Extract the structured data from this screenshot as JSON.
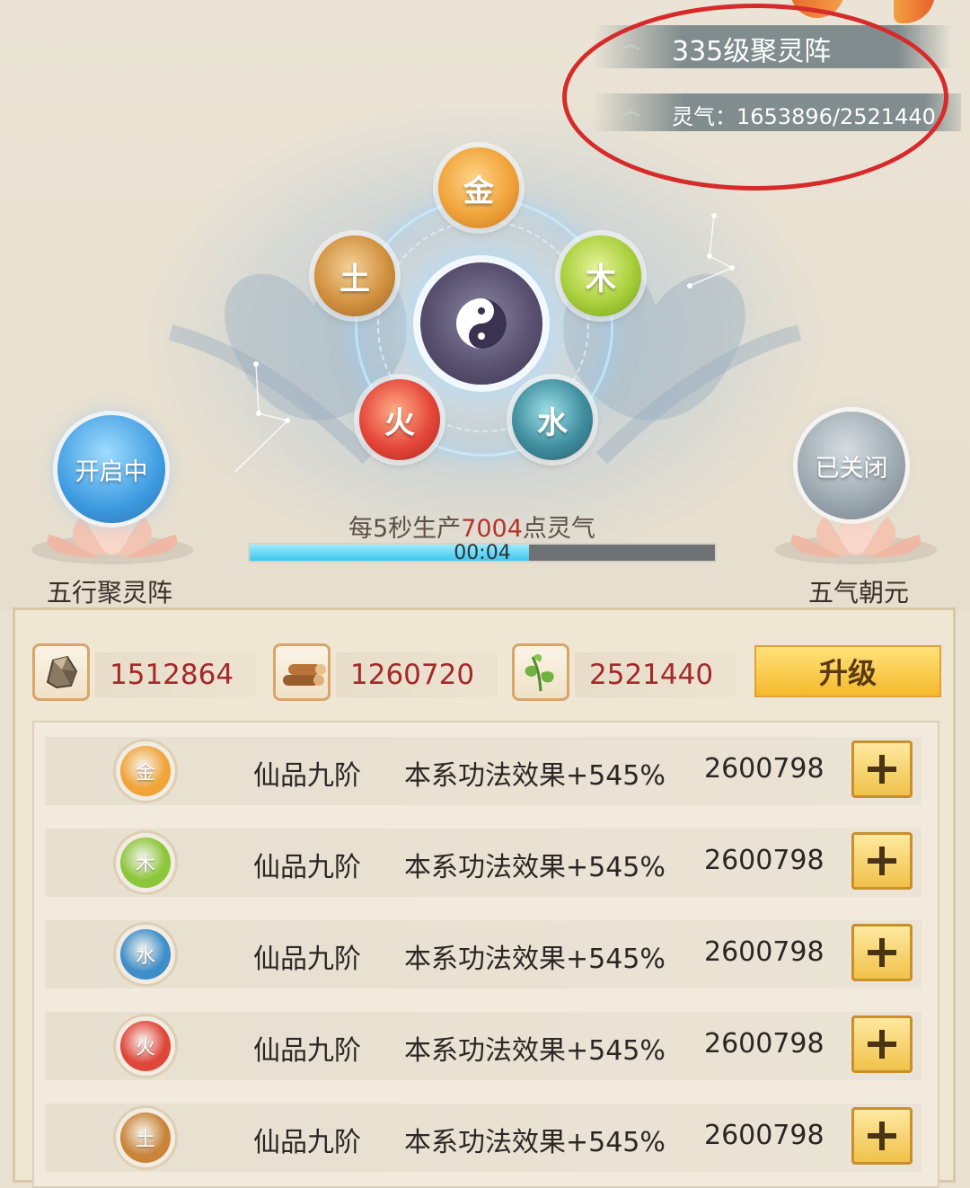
{
  "header": {
    "array_title": "335级聚灵阵",
    "qi_label": "灵气：1653896/2521440"
  },
  "elements": {
    "metal": "金",
    "wood": "木",
    "water": "水",
    "fire": "火",
    "earth": "土"
  },
  "left_pedestal": {
    "status": "开启中",
    "label": "五行聚灵阵"
  },
  "right_pedestal": {
    "status": "已关闭",
    "label": "五气朝元"
  },
  "production": {
    "prefix": "每5秒生产",
    "amount": "7004",
    "suffix": "点灵气",
    "timer": "00:04",
    "progress_fraction": 0.6
  },
  "resources": [
    {
      "icon": "spirit-stone-icon",
      "value": "1512864"
    },
    {
      "icon": "wood-logs-icon",
      "value": "1260720"
    },
    {
      "icon": "herb-leaf-icon",
      "value": "2521440"
    }
  ],
  "upgrade_label": "升级",
  "rows": [
    {
      "element": "金",
      "grade": "仙品九阶",
      "effect": "本系功法效果+545%",
      "value": "2600798",
      "color": "#f0a43a"
    },
    {
      "element": "木",
      "grade": "仙品九阶",
      "effect": "本系功法效果+545%",
      "value": "2600798",
      "color": "#8cc63a"
    },
    {
      "element": "水",
      "grade": "仙品九阶",
      "effect": "本系功法效果+545%",
      "value": "2600798",
      "color": "#3f8ec9"
    },
    {
      "element": "火",
      "grade": "仙品九阶",
      "effect": "本系功法效果+545%",
      "value": "2600798",
      "color": "#e0463a"
    },
    {
      "element": "土",
      "grade": "仙品九阶",
      "effect": "本系功法效果+545%",
      "value": "2600798",
      "color": "#c9843a"
    }
  ]
}
